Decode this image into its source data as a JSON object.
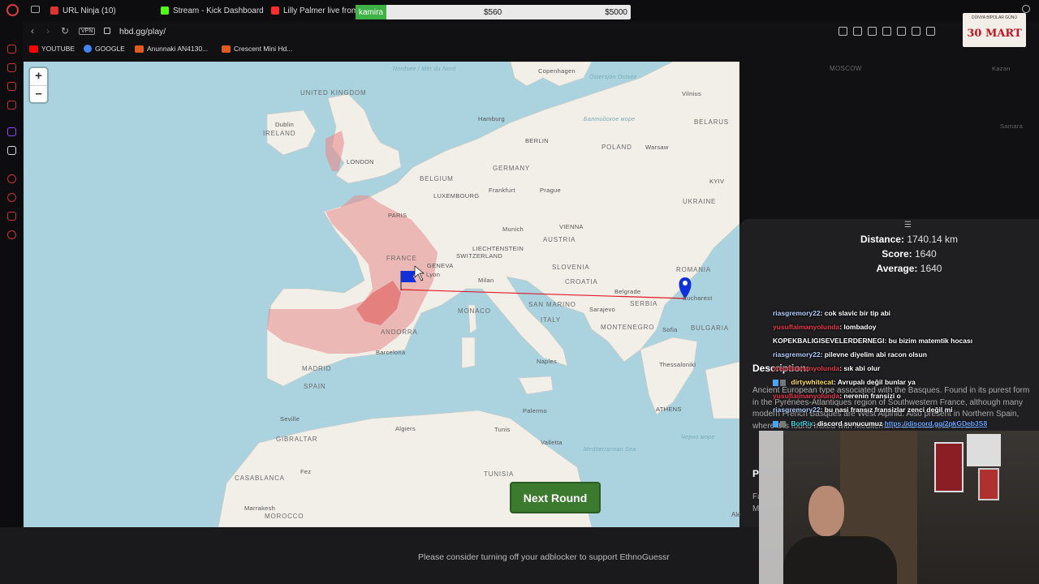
{
  "browser": {
    "tabs": [
      {
        "label": "URL Ninja (10)",
        "color": "#d33"
      },
      {
        "label": "Stream - Kick Dashboard",
        "color": "#53fc18"
      },
      {
        "label": "Lilly Palmer live from h",
        "color": "#ff2d2d"
      }
    ],
    "bid": {
      "name": "kamira",
      "current": "$560",
      "max": "$5000"
    },
    "vpn": "VPN",
    "url": "hbd.gg/play/",
    "bookmarks": [
      {
        "label": "YOUTUBE",
        "color": "#ff0000"
      },
      {
        "label": "GOOGLE",
        "color": "#4285f4"
      },
      {
        "label": "Anunnaki AN4130...",
        "color": "#e15b1e"
      },
      {
        "label": "Crescent Mini Hd...",
        "color": "#e15b1e"
      }
    ],
    "overlay_banner": {
      "small": "DÜNYA BİPOLAR GÜNÜ",
      "big": "30 MART"
    },
    "sidebar_label": "GX"
  },
  "map": {
    "zoom_in": "+",
    "zoom_out": "–",
    "labels": {
      "uk": "UNITED KINGDOM",
      "ireland": "IRELAND",
      "dublin": "Dublin",
      "london": "LONDON",
      "belgium": "BELGIUM",
      "luxembourg": "LUXEMBOURG",
      "paris": "PARIS",
      "france": "FRANCE",
      "geneva": "GENEVA",
      "lyon": "Lyon",
      "liechtenstein": "LIECHTENSTEIN",
      "switzerland": "SWITZERLAND",
      "germany": "GERMANY",
      "hamburg": "Hamburg",
      "berlin": "BERLIN",
      "frankfurt": "Frankfurt",
      "prague": "Prague",
      "munich": "Munich",
      "vienna": "VIENNA",
      "austria": "AUSTRIA",
      "slovenia": "SLOVENIA",
      "croatia": "CROATIA",
      "milan": "Milan",
      "monaco": "MONACO",
      "san_marino": "SAN MARINO",
      "italy": "ITALY",
      "belgrade": "Belgrade",
      "serbia": "SERBIA",
      "romania": "ROMANIA",
      "bucharest": "Bucharest",
      "sarajevo": "Sarajevo",
      "montenegro": "MONTENEGRO",
      "sofia": "Sofia",
      "bulgaria": "BULGARIA",
      "thessaloniki": "Thessaloniki",
      "athens": "ATHENS",
      "naples": "Naples",
      "palermo": "Palermo",
      "tunis": "Tunis",
      "tunisia": "TUNISIA",
      "valletta": "Valletta",
      "algiers": "Algiers",
      "madrid": "MADRID",
      "spain": "SPAIN",
      "andorra": "ANDORRA",
      "barcelona": "Barcelona",
      "seville": "Seville",
      "gibraltar": "GIBRALTAR",
      "casablanca": "CASABLANCA",
      "fez": "Fez",
      "marrakesh": "Marrakesh",
      "morocco": "MOROCCO",
      "poland": "POLAND",
      "warsaw": "Warsaw",
      "copenhagen": "Copenhagen",
      "vilnius": "Vilnius",
      "belarus": "BELARUS",
      "moscow": "MOSCOW",
      "kazan": "Kazan",
      "samara": "Samara",
      "kyiv": "KYIV",
      "ukraine": "UKRAINE",
      "north_sea": "Nordsee / Mer du Nord",
      "ostsee": "Östersjön Ostsee",
      "baltic": "Балтийское море",
      "mediterranean": "Mediterranean Sea",
      "black_sea": "Черно море"
    },
    "button": "Next Round",
    "clipped_label": "Ale"
  },
  "panel": {
    "handle": "☰",
    "distance_label": "Distance:",
    "distance_value": "1740.14 km",
    "score_label": "Score:",
    "score_value": "1640",
    "average_label": "Average:",
    "average_value": "1640",
    "description_label": "Description:",
    "description_text": "Ancient European type associated with the Basques. Found in its purest form in the Pyrénées-Atlantiques region of Southwestern France, although many modern French Basques are West Alpinid. Also present in Northern Spain, where it is found mixed with Mediterranid and thus less b... Li...",
    "p_label": "P",
    "p_text": "Fa M B"
  },
  "chat": [
    {
      "user": "riasgremory22",
      "color": "default",
      "text": ": cok slavic bir tip abi"
    },
    {
      "user": "yusuflaimanyolunda",
      "color": "red",
      "text": ": lombadoy"
    },
    {
      "user": "KOPEKBALIGISEVELERDERNEGI",
      "color": "white",
      "text": ": bu bizim matemtik hocası"
    },
    {
      "user": "riasgremory22",
      "color": "default",
      "text": ": pilevne diyelim abi racon olsun"
    },
    {
      "user": "yusuflaimanyolunda",
      "color": "red",
      "text": ": sık abi olur"
    },
    {
      "user": "dirtywhitecat",
      "color": "yellow",
      "text": ": Avrupalı değil bunlar ya"
    },
    {
      "user": "yusuflaimanyolunda",
      "color": "red",
      "text": ": nerenin fransizi o"
    },
    {
      "user": "riasgremory22",
      "color": "default",
      "text": ": bu nasi fransız fransizlar zenci değil mi"
    },
    {
      "user": "BotRix",
      "color": "cyan",
      "text": ": discord sunucumuz ",
      "link": "https://discord.gg/2pkGDeb3S8"
    }
  ],
  "footer": {
    "adblock": "Please consider turning off your adblocker to support EthnoGuessr"
  },
  "colors": {
    "sea": "#aad3df",
    "land": "#f2efe9",
    "guess_region": "#e88a8a",
    "guess_line": "#e0192b",
    "marker": "#1030d8",
    "button": "#3b7a2f"
  }
}
